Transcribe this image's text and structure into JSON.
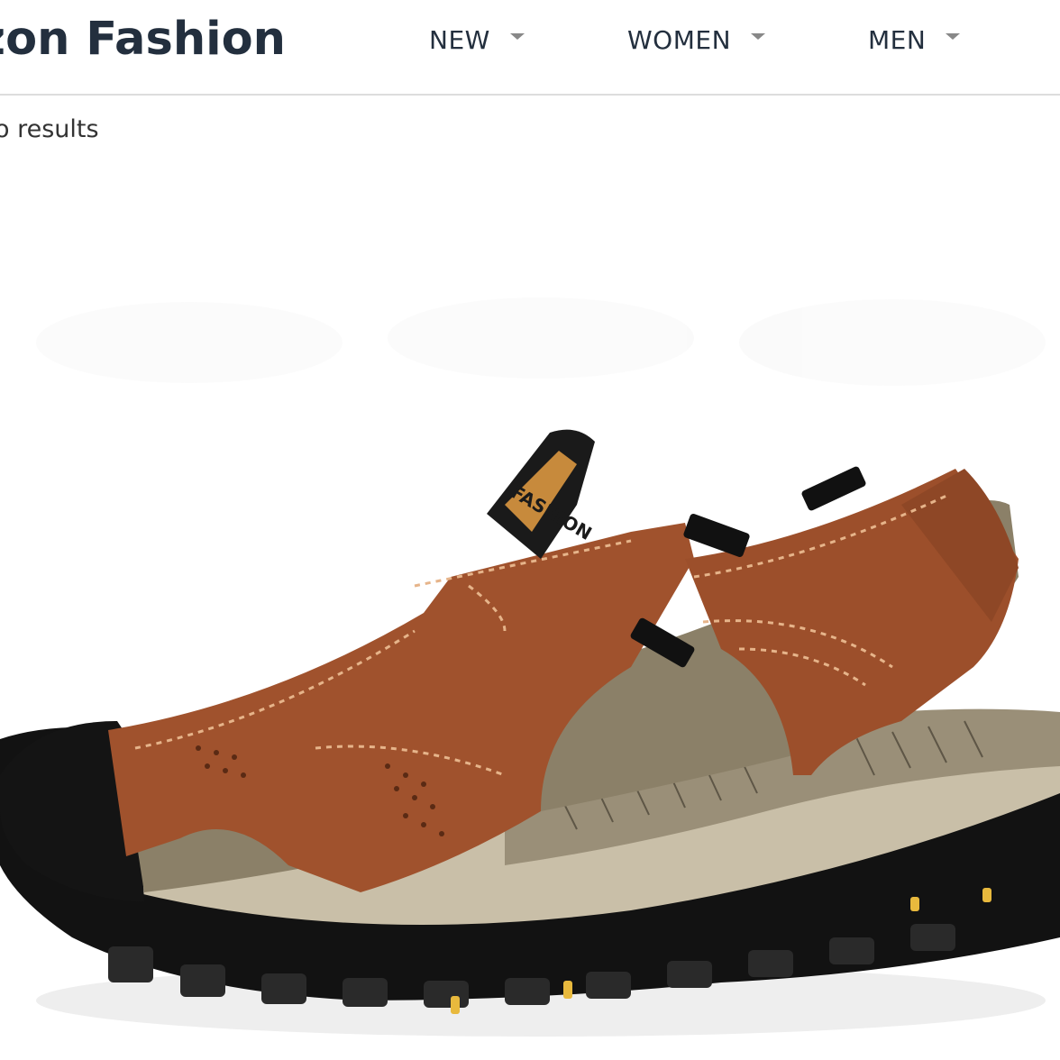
{
  "header": {
    "brand": "azon Fashion",
    "nav": [
      {
        "label": "NEW",
        "icon": "chevron-down-icon"
      },
      {
        "label": "WOMEN",
        "icon": "chevron-down-icon"
      },
      {
        "label": "MEN",
        "icon": "chevron-down-icon"
      }
    ]
  },
  "results": {
    "text": "o results"
  },
  "product": {
    "image": "sandal-image",
    "brand_tag": "FASHION",
    "colors": {
      "leather": "#a0522d",
      "lining": "#8b8068",
      "sole": "#c9bfa8",
      "outsole": "#111111",
      "accent": "#e8b93d"
    }
  },
  "colors": {
    "header_text": "#232f3e",
    "divider": "#dddddd",
    "caret": "#888888"
  }
}
